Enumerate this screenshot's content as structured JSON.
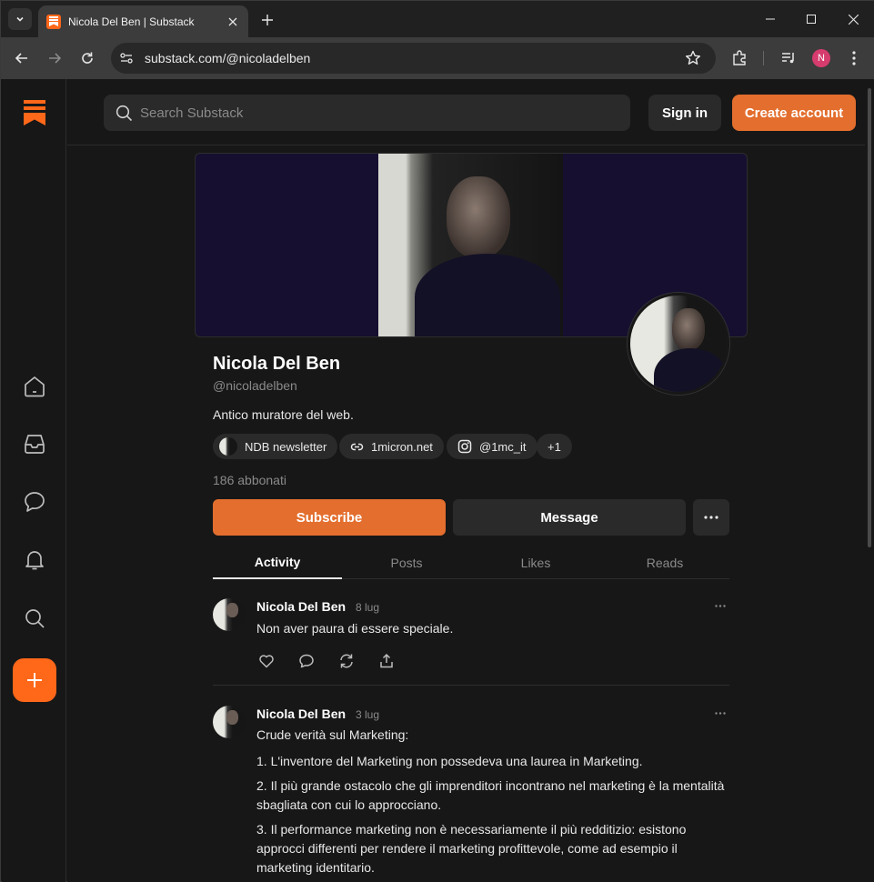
{
  "browser": {
    "tab_title": "Nicola Del Ben | Substack",
    "url": "substack.com/@nicoladelben",
    "profile_initial": "N",
    "accent_color": "#ff6719"
  },
  "header": {
    "search_placeholder": "Search Substack",
    "sign_in": "Sign in",
    "create_account": "Create account"
  },
  "sidebar": {
    "items": [
      {
        "icon": "home-icon"
      },
      {
        "icon": "inbox-icon"
      },
      {
        "icon": "chat-icon"
      },
      {
        "icon": "bell-icon"
      },
      {
        "icon": "search-icon"
      },
      {
        "icon": "plus-icon"
      }
    ]
  },
  "profile": {
    "name": "Nicola Del Ben",
    "handle": "@nicoladelben",
    "bio": "Antico muratore del web.",
    "links": [
      "NDB newsletter",
      "1micron.net",
      "@1mc_it",
      "+1"
    ],
    "subscribers": "186 abbonati",
    "subscribe_label": "Subscribe",
    "message_label": "Message"
  },
  "tabs": [
    "Activity",
    "Posts",
    "Likes",
    "Reads"
  ],
  "posts": [
    {
      "author": "Nicola Del Ben",
      "date": "8 lug",
      "text": "Non aver paura di essere speciale."
    },
    {
      "author": "Nicola Del Ben",
      "date": "3 lug",
      "intro": "Crude verità sul Marketing:",
      "p1": "1. L'inventore del Marketing non possedeva una laurea in Marketing.",
      "p2": "2. Il più grande ostacolo che gli imprenditori incontrano nel marketing è la mentalità sbagliata con cui lo approcciano.",
      "p3": "3. Il performance marketing non è necessariamente il più redditizio: esistono approcci differenti per rendere il marketing profittevole, come ad esempio il marketing identitario."
    }
  ]
}
